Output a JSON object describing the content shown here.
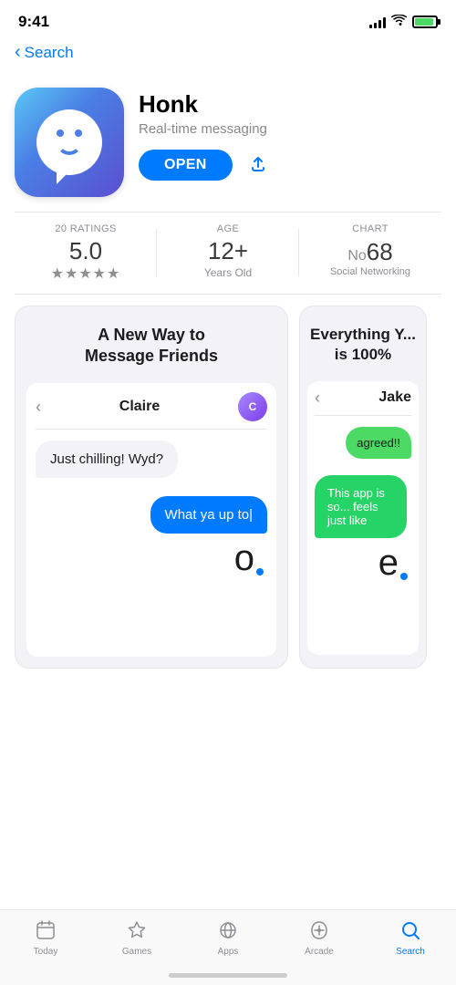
{
  "statusBar": {
    "time": "9:41",
    "backLabel": "Search"
  },
  "nav": {
    "backLabel": "Search"
  },
  "app": {
    "name": "Honk",
    "subtitle": "Real-time messaging",
    "openButton": "OPEN",
    "ratings": "20 RATINGS",
    "ratingValue": "5.0",
    "stars": "★★★★★",
    "ageLabel": "AGE",
    "ageValue": "12+",
    "ageSub": "Years Old",
    "chartLabel": "CHART",
    "chartNo": "No",
    "chartNum": "68",
    "chartCat": "Social Networking"
  },
  "screenshots": [
    {
      "title": "A New Way to Message Friends",
      "chatName": "Claire",
      "receivedMsg": "Just chilling! Wyd?",
      "sentMsg": "What ya up to|",
      "keyLetter": "o"
    },
    {
      "title": "Everything Y... is 100%",
      "chatName": "Jake",
      "msg1": "agreed!!",
      "msg2": "This app is so... feels just like",
      "keyLetter": "e"
    }
  ],
  "tabBar": {
    "items": [
      {
        "id": "today",
        "label": "Today",
        "active": false
      },
      {
        "id": "games",
        "label": "Games",
        "active": false
      },
      {
        "id": "apps",
        "label": "Apps",
        "active": false
      },
      {
        "id": "arcade",
        "label": "Arcade",
        "active": false
      },
      {
        "id": "search",
        "label": "Search",
        "active": true
      }
    ]
  }
}
